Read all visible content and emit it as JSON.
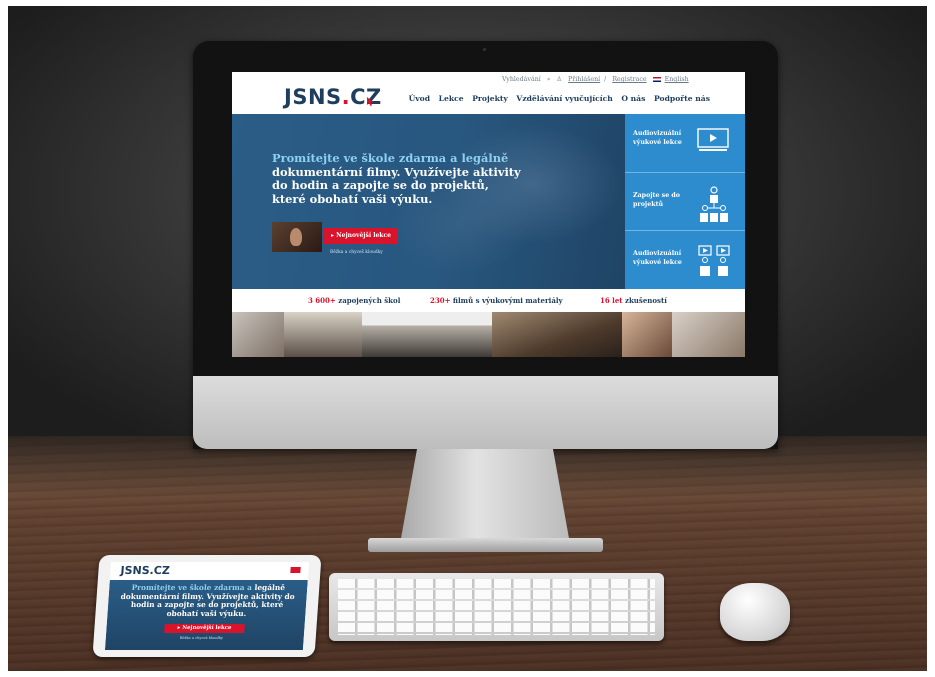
{
  "site": {
    "logo_main": "JSNS",
    "logo_dot": ".",
    "logo_tld": "CZ"
  },
  "utility": {
    "search_label": "Vyhledávání",
    "login": "Přihlášení",
    "separator": "/",
    "register": "Registrace",
    "language": "English"
  },
  "nav": [
    "Úvod",
    "Lekce",
    "Projekty",
    "Vzdělávání vyučujících",
    "O nás",
    "Podpořte nás"
  ],
  "hero": {
    "headline_highlight": "Promítejte ve škole zdarma a legálně",
    "headline_rest": "dokumentární filmy. Využívejte aktivity do hodin a zapojte se do projektů, které obohatí vaši výuku.",
    "cta_label": "Nejnovější lekce",
    "cta_subtitle": "Běžka a chyceš kloudky"
  },
  "side_panel": [
    {
      "label": "Audiovizuální výukové lekce",
      "icon": "video-screen-icon"
    },
    {
      "label": "Zapojte se do projektů",
      "icon": "people-network-icon"
    },
    {
      "label": "Audiovizuální výukové lekce",
      "icon": "students-video-icon"
    }
  ],
  "stats": [
    {
      "number": "3 600+",
      "label": "zapojených škol"
    },
    {
      "number": "230+",
      "label": "filmů s výukovými materiály"
    },
    {
      "number": "16 let",
      "label": "zkušeností"
    }
  ],
  "tablet": {
    "logo": "JSNS.CZ",
    "headline_highlight": "Promítejte ve škole zdarma a",
    "headline_rest": "legálně dokumentární filmy. Využívejte aktivity do hodin a zapojte se do projektů, které obohatí vaši výuku.",
    "cta_label": "Nejnovější lekce",
    "cta_subtitle": "Běžka a chyceš kloudky"
  },
  "colors": {
    "brand_navy": "#1f3d5c",
    "brand_red": "#d8132b",
    "hero_blue": "#28577f",
    "side_blue": "#2d8ccd",
    "highlight_cyan": "#8ed0ef"
  }
}
